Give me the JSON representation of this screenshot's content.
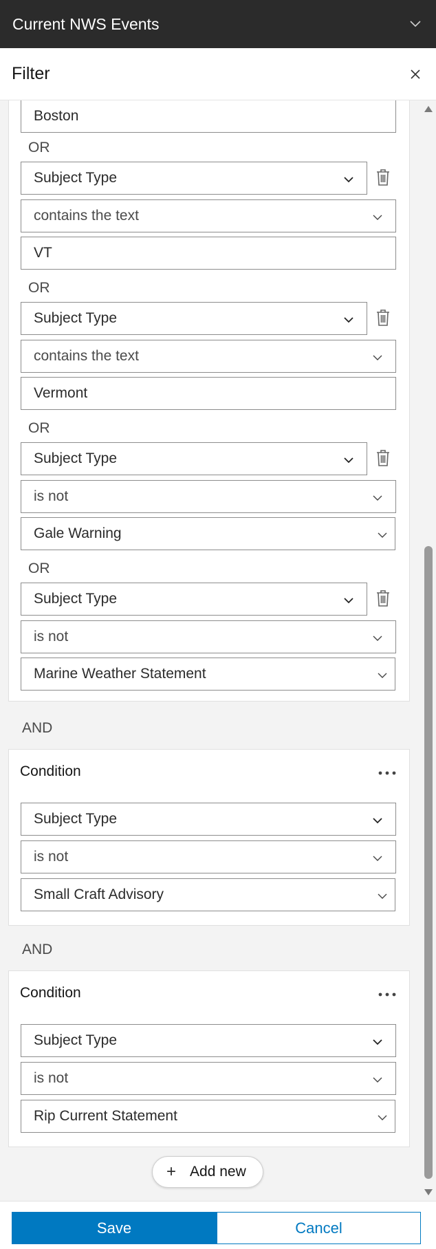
{
  "app": {
    "title": "Current NWS Events"
  },
  "panel": {
    "title": "Filter"
  },
  "group1": {
    "or_label": "OR",
    "rows": [
      {
        "value": "Boston"
      },
      {
        "field": "Subject Type",
        "operator": "contains the text",
        "value": "VT"
      },
      {
        "field": "Subject Type",
        "operator": "contains the text",
        "value": "Vermont"
      },
      {
        "field": "Subject Type",
        "operator": "is not",
        "value": "Gale Warning"
      },
      {
        "field": "Subject Type",
        "operator": "is not",
        "value": "Marine Weather Statement"
      }
    ]
  },
  "and_label": "AND",
  "conditions": [
    {
      "title": "Condition",
      "field": "Subject Type",
      "operator": "is not",
      "value": "Small Craft Advisory"
    },
    {
      "title": "Condition",
      "field": "Subject Type",
      "operator": "is not",
      "value": "Rip Current Statement"
    }
  ],
  "add_new_label": "Add new",
  "footer": {
    "save_label": "Save",
    "cancel_label": "Cancel"
  },
  "colors": {
    "brand_blue": "#0079c1",
    "titlebar_bg": "#2b2b2b"
  }
}
